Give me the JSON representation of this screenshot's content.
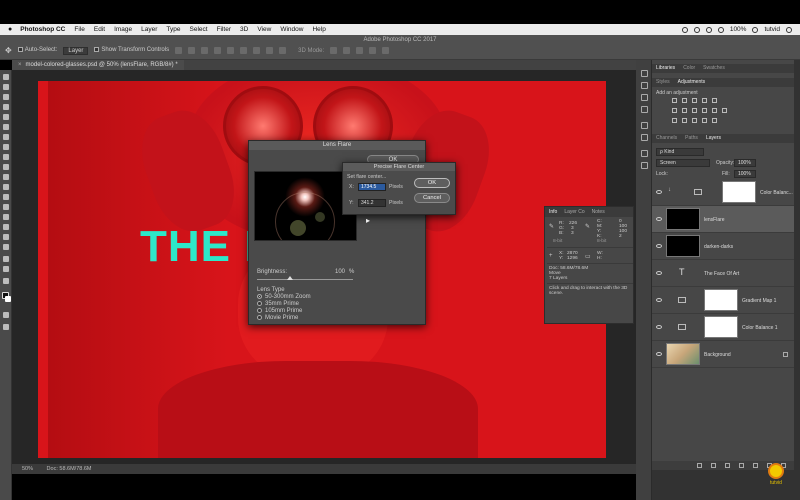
{
  "menubar": {
    "apple": "",
    "items": [
      "Photoshop CC",
      "File",
      "Edit",
      "Image",
      "Layer",
      "Type",
      "Select",
      "Filter",
      "3D",
      "View",
      "Window",
      "Help"
    ],
    "battery": "100%",
    "user": "tutvid"
  },
  "app": {
    "title": "Adobe Photoshop CC 2017"
  },
  "options": {
    "auto_select": "Auto-Select:",
    "auto_select_value": "Layer",
    "show_transform": "Show Transform Controls",
    "mode_3d": "3D Mode:"
  },
  "document": {
    "tab": "model-colored-glasses.psd @ 50% (lensFlare, RGB/8#) *",
    "close": "×"
  },
  "canvas_text": "THE F   F ART",
  "status": {
    "zoom": "50%",
    "doc": "Doc: 58.6M/78.6M"
  },
  "lens_flare": {
    "title": "Lens Flare",
    "ok": "OK",
    "brightness_label": "Brightness:",
    "brightness_value": "100",
    "brightness_unit": "%",
    "brightness_level": 0.34,
    "lens_type_label": "Lens Type",
    "lens_types": [
      {
        "label": "50-300mm Zoom",
        "selected": true
      },
      {
        "label": "35mm Prime",
        "selected": false
      },
      {
        "label": "105mm Prime",
        "selected": false
      },
      {
        "label": "Movie Prime",
        "selected": false
      }
    ]
  },
  "precise": {
    "title": "Precise Flare Center",
    "set_label": "Set flare center...",
    "x_label": "X:",
    "x_value": "1734.5",
    "y_label": "Y:",
    "y_value": "341.2",
    "unit": "Pixels",
    "ok": "OK",
    "cancel": "Cancel"
  },
  "info": {
    "tabs": [
      "Info",
      "Layer Co",
      "Notes"
    ],
    "rgb": {
      "r_label": "R:",
      "r": "226",
      "g_label": "G:",
      "g": "3",
      "b_label": "B:",
      "b": "3"
    },
    "cmyk": {
      "c_label": "C:",
      "c": "0",
      "m_label": "M:",
      "m": "100",
      "y_label": "Y:",
      "y": "100",
      "k_label": "K:",
      "k": "2"
    },
    "bit1": "8-bit",
    "bit2": "8-bit",
    "x_label": "X:",
    "x": "2870",
    "y_label": "Y:",
    "y": "1296",
    "w_label": "W:",
    "h_label": "H:",
    "doc": "Doc: 58.6M/78.6M",
    "move": "Move",
    "layers": "7 Layers",
    "hint": "Click and drag to interact with the 3D scene."
  },
  "panels": {
    "top_tabs": [
      "Libraries",
      "Color",
      "Swatches"
    ],
    "style_tabs": [
      "Styles",
      "Adjustments"
    ],
    "add_adjustment": "Add an adjustment",
    "layer_tabs": [
      "Channels",
      "Paths",
      "Layers"
    ],
    "kind": "Kind",
    "blend": "Screen",
    "opacity_label": "Opacity:",
    "opacity": "100%",
    "lock_label": "Lock:",
    "fill_label": "Fill:",
    "fill": "100%"
  },
  "layers": [
    {
      "name": "Color Balanc...",
      "thumb": "white",
      "adj": true
    },
    {
      "name": "lensFlare",
      "thumb": "black",
      "selected": true
    },
    {
      "name": "darken-darks",
      "thumb": "black"
    },
    {
      "name": "The Face Of Art",
      "thumb": "text"
    },
    {
      "name": "Gradient Map 1",
      "thumb": "white",
      "adj": true
    },
    {
      "name": "Color Balance 1",
      "thumb": "white",
      "adj": true
    },
    {
      "name": "Background",
      "thumb": "photo"
    }
  ],
  "watermark": "tutvid",
  "colors": {
    "accent_text": "#2de8c9",
    "canvas_red": "#d8141a"
  }
}
